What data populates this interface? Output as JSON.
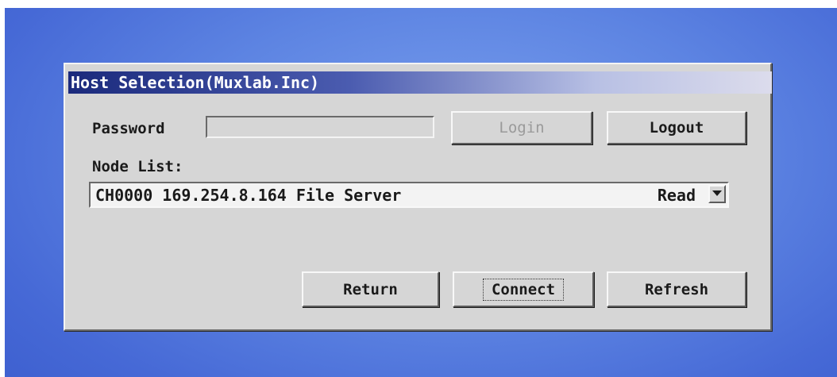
{
  "window": {
    "title": "Host Selection(Muxlab.Inc)"
  },
  "login": {
    "password_label": "Password",
    "password_value": "",
    "login_label": "Login",
    "logout_label": "Logout"
  },
  "node_list": {
    "label": "Node List:",
    "selected": "CH0000 169.254.8.164 File Server",
    "status": "Read"
  },
  "actions": {
    "return_label": "Return",
    "connect_label": "Connect",
    "refresh_label": "Refresh"
  },
  "icons": {
    "dropdown": "chevron-down-icon"
  },
  "colors": {
    "desktop": "#5d84e2",
    "dialog": "#d6d6d6",
    "titlebar_start": "#1b2a7c",
    "titlebar_end": "#dcdcec",
    "disabled_text": "#9a9a9a"
  }
}
